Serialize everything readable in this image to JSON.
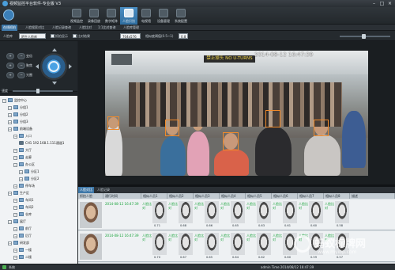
{
  "window": {
    "title": "视频监控平台软件-专业版  V3"
  },
  "toolbar": {
    "items": [
      {
        "label": "视频监控"
      },
      {
        "label": "录像回放"
      },
      {
        "label": "数字矩阵"
      },
      {
        "label": "人脸识别"
      },
      {
        "label": "电视墙"
      },
      {
        "label": "设备管理"
      },
      {
        "label": "系统配置"
      }
    ]
  },
  "tabs": [
    "在线抓拍",
    "人脸搜索对比",
    "人脸记录查询",
    "人脸比对",
    "1:1比对查询",
    "人脸库管理"
  ],
  "controls": {
    "face_lib_label": "人脸库",
    "face_lib_value": "陌生人脸库",
    "opt_checkbox": "抓拍显示",
    "opt_align": "比对结果",
    "resolution_value": "704x576",
    "threshold_label": "相似度阈值(0.5~1)",
    "threshold_value": "0.8"
  },
  "ptz": {
    "left_buttons": [
      "变倍",
      "聚焦",
      "光圈"
    ],
    "speed_label": "速度"
  },
  "tree": [
    {
      "label": "监控中心",
      "level": 0,
      "kind": "folder"
    },
    {
      "label": "分组1",
      "level": 1,
      "kind": "folder"
    },
    {
      "label": "分组2",
      "level": 1,
      "kind": "folder"
    },
    {
      "label": "分组3",
      "level": 1,
      "kind": "folder"
    },
    {
      "label": "前端设备",
      "level": 1,
      "kind": "folder"
    },
    {
      "label": "入口",
      "level": 2,
      "kind": "folder"
    },
    {
      "label": "CH1 192.168.1.111通道1",
      "level": 3,
      "kind": "camera"
    },
    {
      "label": "大厅",
      "level": 2,
      "kind": "folder"
    },
    {
      "label": "走廊",
      "level": 2,
      "kind": "folder"
    },
    {
      "label": "办公区",
      "level": 2,
      "kind": "folder"
    },
    {
      "label": "分区1",
      "level": 3,
      "kind": "folder"
    },
    {
      "label": "分区2",
      "level": 3,
      "kind": "folder"
    },
    {
      "label": "停车场",
      "level": 2,
      "kind": "folder"
    },
    {
      "label": "生产区",
      "level": 1,
      "kind": "folder"
    },
    {
      "label": "车间1",
      "level": 2,
      "kind": "folder"
    },
    {
      "label": "车间2",
      "level": 2,
      "kind": "folder"
    },
    {
      "label": "仓库",
      "level": 2,
      "kind": "folder"
    },
    {
      "label": "展厅",
      "level": 1,
      "kind": "folder"
    },
    {
      "label": "前厅",
      "level": 2,
      "kind": "folder"
    },
    {
      "label": "后厅",
      "level": 2,
      "kind": "folder"
    },
    {
      "label": "研发部",
      "level": 1,
      "kind": "folder"
    },
    {
      "label": "一楼",
      "level": 2,
      "kind": "folder"
    },
    {
      "label": "二楼",
      "level": 2,
      "kind": "folder"
    }
  ],
  "video": {
    "timestamp": "2014-08-12 16:47:39",
    "sign_text": "禁止掉头 NO U-TURNS"
  },
  "results": {
    "tabs": [
      "人脸对比",
      "人脸记录"
    ],
    "headers": [
      "抓拍人脸",
      "通行时间",
      "相似人员1",
      "相似人员2",
      "相似人员3",
      "相似人员4",
      "相似人员5",
      "相似人员6",
      "相似人员7",
      "相似人员8",
      "描述"
    ],
    "rows": [
      {
        "time": "2014-08-12 16:47:39",
        "match": "人脸比对",
        "scores": [
          "0.71",
          "0.68",
          "0.66",
          "0.65",
          "0.63",
          "0.61",
          "0.60",
          "0.58"
        ]
      },
      {
        "time": "2014-08-12 16:47:39",
        "match": "人脸比对",
        "scores": [
          "0.70",
          "0.67",
          "0.65",
          "0.64",
          "0.62",
          "0.60",
          "0.59",
          "0.57"
        ]
      }
    ]
  },
  "status": {
    "left": "系统",
    "right": "admin  Time 2014/08/12 16:47:39"
  },
  "watermark": {
    "line1": "蚂蚁标牌网",
    "line2": "www.myibp.com"
  }
}
